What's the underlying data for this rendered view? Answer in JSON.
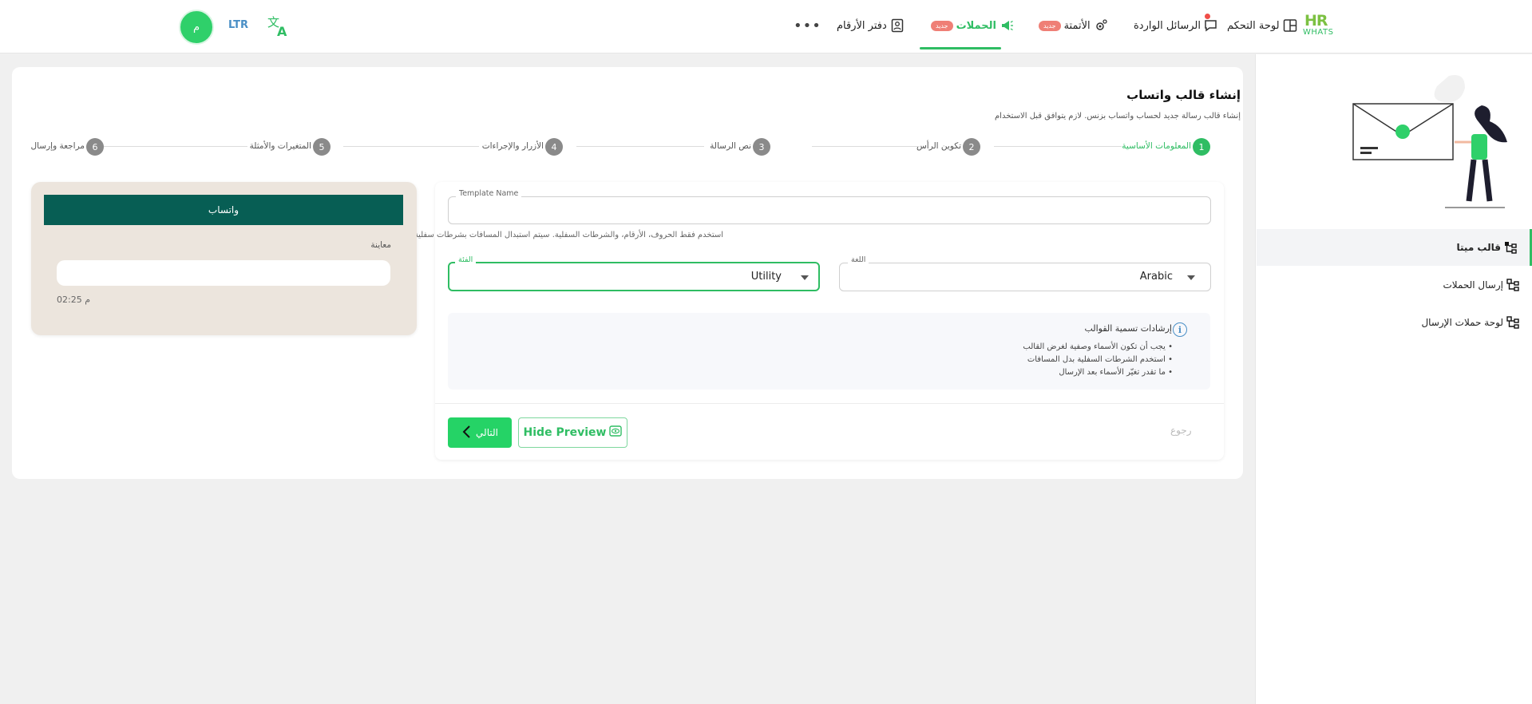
{
  "brand": {
    "line1": "HR",
    "line2": "WHATS"
  },
  "nav": {
    "items": [
      {
        "label": "لوحة التحكم",
        "icon": "dashboard-icon"
      },
      {
        "label": "الرسائل الواردة",
        "icon": "inbox-icon"
      },
      {
        "label": "الأتمتة",
        "icon": "automation-icon",
        "badge": "جديد"
      },
      {
        "label": "الحملات",
        "icon": "megaphone-icon",
        "badge": "جديد"
      },
      {
        "label": "دفتر الأرقام",
        "icon": "contacts-icon"
      }
    ],
    "more": "•••",
    "direction_toggle": "LTR",
    "avatar_initial": "م"
  },
  "sidebar": {
    "items": [
      {
        "label": "قالب ميتا",
        "icon": "template-tree-icon"
      },
      {
        "label": "إرسال الحملات",
        "icon": "send-tree-icon"
      },
      {
        "label": "لوحة حملات الإرسال",
        "icon": "campaign-board-tree-icon"
      }
    ]
  },
  "page": {
    "title": "إنشاء قالب واتساب",
    "subtitle": "إنشاء قالب رسالة جديد لحساب واتساب بزنس. لازم يتوافق قبل الاستخدام"
  },
  "stepper": {
    "steps": [
      {
        "num": "1",
        "label": "المعلومات الأساسية"
      },
      {
        "num": "2",
        "label": "تكوين الرأس"
      },
      {
        "num": "3",
        "label": "نص الرسالة"
      },
      {
        "num": "4",
        "label": "الأزرار والإجراءات"
      },
      {
        "num": "5",
        "label": "المتغيرات والأمثلة"
      },
      {
        "num": "6",
        "label": "مراجعة وإرسال"
      }
    ]
  },
  "form": {
    "template_name_label": "Template Name",
    "template_name_value": "",
    "template_name_helper": "استخدم فقط الحروف، الأرقام، والشرطات السفلية. سيتم استبدال المسافات بشرطات سفلية.",
    "language_label": "اللغة",
    "language_value": "Arabic",
    "category_label": "الفئة",
    "category_value": "Utility",
    "guide_title": "إرشادات تسمية القوالب",
    "guide_lines": [
      "• يجب أن تكون الأسماء وصفية لغرض القالب",
      "• استخدم الشرطات السفلية بدل المسافات",
      "• ما تقدر تغيّر الأسماء بعد الإرسال"
    ],
    "next_label": "التالي",
    "preview_label": "Hide Preview",
    "back_label": "رجوع"
  },
  "preview": {
    "header": "واتساب",
    "label": "معاينة",
    "time": "02:25 م"
  },
  "colors": {
    "accent": "#2fbd63",
    "whatsapp_dark": "#075e54",
    "badge": "#ef7f76",
    "chat_bg": "#ece5dd"
  }
}
